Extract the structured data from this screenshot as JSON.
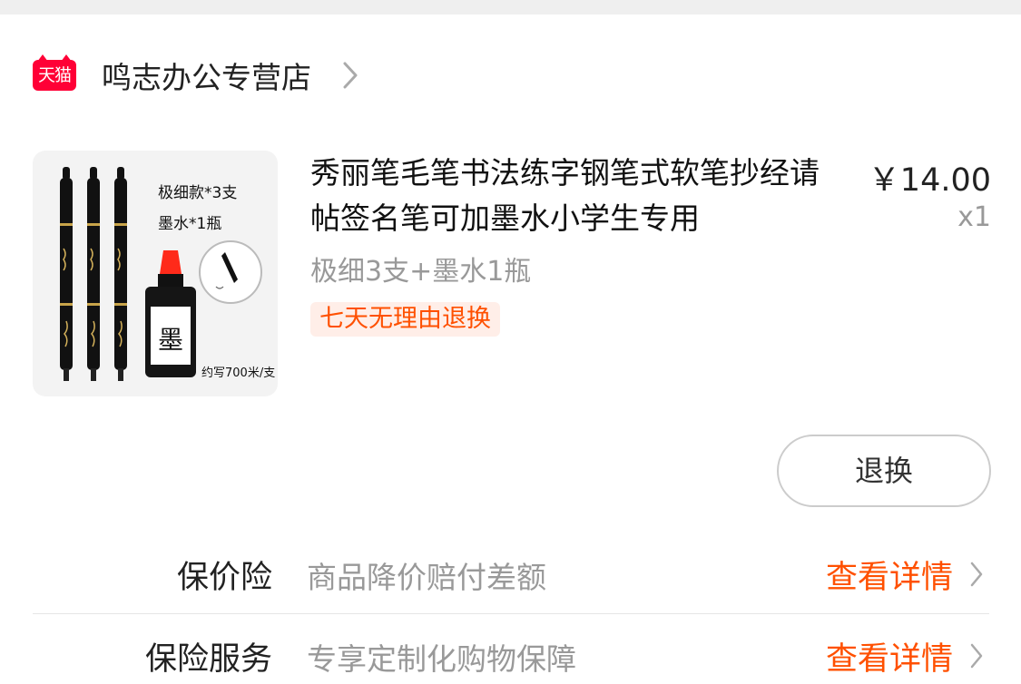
{
  "store": {
    "badge": "天猫",
    "name": "鸣志办公专营店"
  },
  "product": {
    "image": {
      "text_line1": "极细款*3支",
      "text_line2": "墨水*1瓶",
      "text_line3": "约写700米/支",
      "bottle_char": "墨"
    },
    "title": "秀丽笔毛笔书法练字钢笔式软笔抄经请帖签名笔可加墨水小学生专用",
    "variant": "极细3支+墨水1瓶",
    "tag": "七天无理由退换",
    "price": "￥14.00",
    "qty": "x1"
  },
  "actions": {
    "return_label": "退换"
  },
  "services": [
    {
      "label": "保价险",
      "desc": "商品降价赔付差额",
      "link": "查看详情"
    },
    {
      "label": "保险服务",
      "desc": "专享定制化购物保障",
      "link": "查看详情"
    }
  ],
  "colors": {
    "accent": "#ff5000",
    "tmall_red": "#ff0036",
    "muted_text": "#999999"
  }
}
